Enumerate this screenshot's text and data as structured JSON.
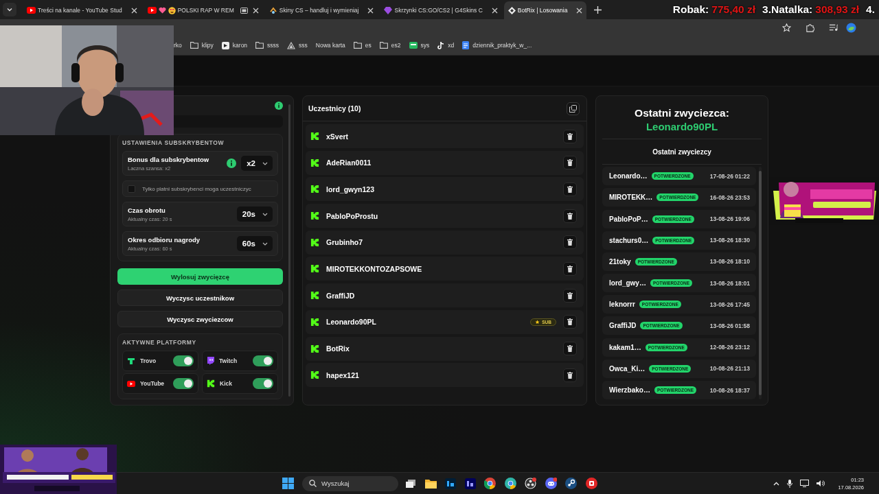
{
  "browser": {
    "tabs": [
      {
        "title": "Treści na kanale - YouTube Stud",
        "kind": "youtube",
        "selected": false
      },
      {
        "title": "POLSKI RAP W REM",
        "kind": "music",
        "selected": false
      },
      {
        "title": "Skiny CS – handluj i wymieniaj",
        "kind": "skins",
        "selected": false
      },
      {
        "title": "Skrzynki CS:GO/CS2 | G4Skins C",
        "kind": "crate",
        "selected": false
      },
      {
        "title": "BotRix | Losowania",
        "kind": "bot",
        "selected": true
      }
    ],
    "bookmarks": [
      {
        "label": "rko",
        "kind": "plain"
      },
      {
        "label": "klipy",
        "kind": "folder"
      },
      {
        "label": "karon",
        "kind": "site"
      },
      {
        "label": "ssss",
        "kind": "folder"
      },
      {
        "label": "sss",
        "kind": "triangle"
      },
      {
        "label": "Nowa karta",
        "kind": "plain"
      },
      {
        "label": "es",
        "kind": "folder"
      },
      {
        "label": "es2",
        "kind": "folder"
      },
      {
        "label": "sys",
        "kind": "green"
      },
      {
        "label": "xd",
        "kind": "note"
      },
      {
        "label": "dziennik_praktyk_w_...",
        "kind": "doc"
      }
    ]
  },
  "ranking_overlay": [
    {
      "name": "Robak:",
      "amount": "775,40 zł"
    },
    {
      "name": "3.Natalka:",
      "amount": "308,93 zł"
    },
    {
      "name": "4."
    }
  ],
  "settings": {
    "subscriber_section": {
      "title": "USTAWIENIA SUBSKRYBENTOW",
      "bonus": {
        "label": "Bonus dla subskrybentow",
        "hint": "Laczna szansa: x2",
        "value": "x2"
      },
      "paid_only": {
        "label": "Tylko platni subskrybenci moga uczestniczyc",
        "checked": false
      },
      "spin_time": {
        "label": "Czas obrotu",
        "hint": "Aktualny czas: 20 s",
        "value": "20s"
      },
      "claim_period": {
        "label": "Okres odbioru nagrody",
        "hint": "Aktualny czas: 60 s",
        "value": "60s"
      }
    },
    "buttons": [
      {
        "label": "Wylosuj zwycięzcę",
        "kind": "primary"
      },
      {
        "label": "Wyczysc uczestnikow",
        "kind": "secondary"
      },
      {
        "label": "Wyczysc zwyciezcow",
        "kind": "secondary"
      }
    ],
    "platforms": {
      "title": "AKTYWNE PLATFORMY",
      "items": [
        {
          "name": "Trovo",
          "kind": "trovo",
          "on": true
        },
        {
          "name": "Twitch",
          "kind": "twitch",
          "on": true
        },
        {
          "name": "YouTube",
          "kind": "youtube",
          "on": true
        },
        {
          "name": "Kick",
          "kind": "kick",
          "on": true
        }
      ]
    }
  },
  "participants": {
    "title": "Uczestnicy (10)",
    "items": [
      {
        "name": "xSvert"
      },
      {
        "name": "AdeRian0011"
      },
      {
        "name": "lord_gwyn123"
      },
      {
        "name": "PabloPoProstu"
      },
      {
        "name": "Grubinho7"
      },
      {
        "name": "MIROTEKKONTOZAPSOWE"
      },
      {
        "name": "GraffiJD"
      },
      {
        "name": "Leonardo90PL",
        "badge": "SUB"
      },
      {
        "name": "BotRix"
      },
      {
        "name": "hapex121"
      }
    ]
  },
  "winner": {
    "title": "Ostatni zwyciezca:",
    "name": "Leonardo90PL"
  },
  "recent_winners": {
    "title": "Ostatni zwyciezcy",
    "items": [
      {
        "name": "Leonardo…",
        "status": "POTWIERDZONE",
        "date": "17-08-26 01:22"
      },
      {
        "name": "MIROTEKK…",
        "status": "POTWIERDZONE",
        "date": "16-08-26 23:53"
      },
      {
        "name": "PabloPoP…",
        "status": "POTWIERDZONE",
        "date": "13-08-26 19:06"
      },
      {
        "name": "stachurs0…",
        "status": "POTWIERDZONE",
        "date": "13-08-26 18:30"
      },
      {
        "name": "21toky",
        "status": "POTWIERDZONE",
        "date": "13-08-26 18:10"
      },
      {
        "name": "lord_gwy…",
        "status": "POTWIERDZONE",
        "date": "13-08-26 18:01"
      },
      {
        "name": "leknorrr",
        "status": "POTWIERDZONE",
        "date": "13-08-26 17:45"
      },
      {
        "name": "GraffiJD",
        "status": "POTWIERDZONE",
        "date": "13-08-26 01:58"
      },
      {
        "name": "kakam1…",
        "status": "POTWIERDZONE",
        "date": "12-08-26 23:12"
      },
      {
        "name": "Owca_Ki…",
        "status": "POTWIERDZONE",
        "date": "10-08-26 21:13"
      },
      {
        "name": "Wierzbako…",
        "status": "POTWIERDZONE",
        "date": "10-08-26 18:37"
      }
    ]
  },
  "taskbar": {
    "search_placeholder": "Wyszukaj",
    "time": "01:23",
    "date": "17.08.2026"
  }
}
